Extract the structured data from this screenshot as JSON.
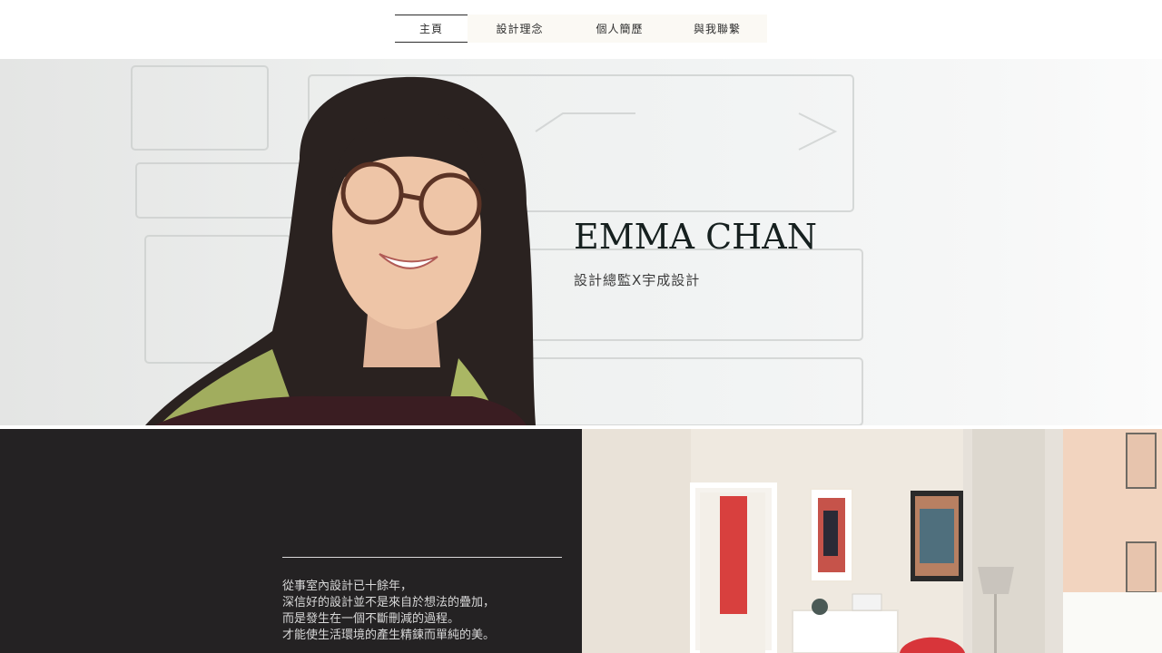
{
  "nav": {
    "items": [
      {
        "label": "主頁",
        "active": true
      },
      {
        "label": "設計理念",
        "active": false
      },
      {
        "label": "個人簡歷",
        "active": false
      },
      {
        "label": "與我聯繫",
        "active": false
      }
    ]
  },
  "hero": {
    "name": "EMMA CHAN",
    "subtitle": "設計總監X宇成設計"
  },
  "about": {
    "lines": [
      "從事室內設計已十餘年，",
      "深信好的設計並不是來自於想法的疊加，",
      "而是發生在一個不斷刪減的過程。",
      "才能使生活環境的產生精鍊而單純的美。"
    ]
  },
  "colors": {
    "dark_panel": "#242223",
    "nav_bg": "#fbf9f4",
    "title": "#16201f"
  }
}
